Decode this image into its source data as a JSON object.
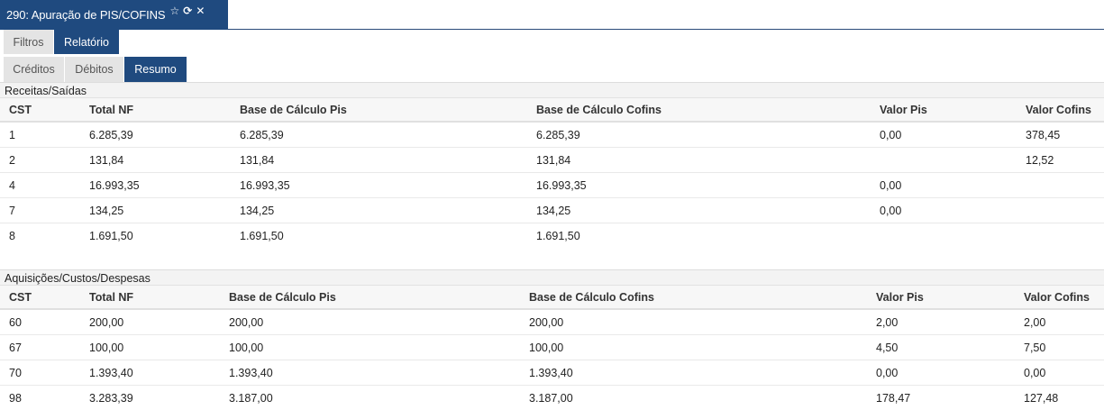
{
  "window_tab": {
    "title": "290: Apuração de PIS/COFINS",
    "icons": [
      "star-icon",
      "refresh-icon",
      "close-icon"
    ]
  },
  "tabs_top": [
    {
      "label": "Filtros",
      "active": false
    },
    {
      "label": "Relatório",
      "active": true
    }
  ],
  "tabs_sub": [
    {
      "label": "Créditos",
      "active": false
    },
    {
      "label": "Débitos",
      "active": false
    },
    {
      "label": "Resumo",
      "active": true
    }
  ],
  "receitas": {
    "title": "Receitas/Saídas",
    "headers": [
      "CST",
      "Total NF",
      "Base de Cálculo Pis",
      "Base de Cálculo Cofins",
      "Valor Pis",
      "Valor Cofins"
    ],
    "rows": [
      [
        "1",
        "6.285,39",
        "6.285,39",
        "6.285,39",
        "0,00",
        "378,45"
      ],
      [
        "2",
        "131,84",
        "131,84",
        "131,84",
        "",
        "12,52"
      ],
      [
        "4",
        "16.993,35",
        "16.993,35",
        "16.993,35",
        "0,00",
        ""
      ],
      [
        "7",
        "134,25",
        "134,25",
        "134,25",
        "0,00",
        ""
      ],
      [
        "8",
        "1.691,50",
        "1.691,50",
        "1.691,50",
        "",
        ""
      ]
    ]
  },
  "aquisicoes": {
    "title": "Aquisições/Custos/Despesas",
    "headers": [
      "CST",
      "Total NF",
      "Base de Cálculo Pis",
      "Base de Cálculo Cofins",
      "Valor Pis",
      "Valor Cofins"
    ],
    "rows": [
      [
        "60",
        "200,00",
        "200,00",
        "200,00",
        "2,00",
        "2,00"
      ],
      [
        "67",
        "100,00",
        "100,00",
        "100,00",
        "4,50",
        "7,50"
      ],
      [
        "70",
        "1.393,40",
        "1.393,40",
        "1.393,40",
        "0,00",
        "0,00"
      ],
      [
        "98",
        "3.283,39",
        "3.187,00",
        "3.187,00",
        "178,47",
        "127,48"
      ]
    ]
  }
}
